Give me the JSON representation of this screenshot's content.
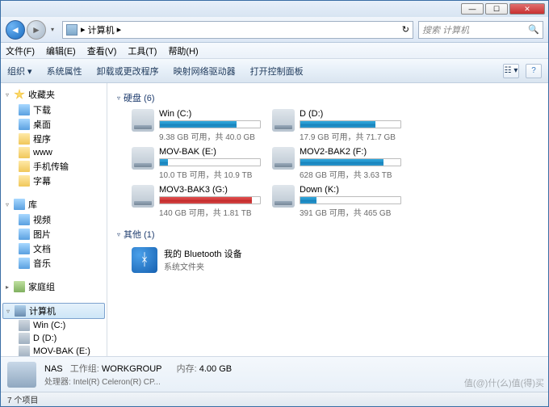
{
  "titlebar": {
    "min": "—",
    "max": "☐",
    "close": "✕"
  },
  "nav": {
    "back": "◄",
    "fwd": "►",
    "drop": "▾",
    "refresh": "↻"
  },
  "breadcrumb": {
    "sep": "▸",
    "loc": "计算机",
    "sep2": "▸"
  },
  "search": {
    "placeholder": "搜索 计算机",
    "icon": "🔍"
  },
  "menubar": [
    "文件(F)",
    "编辑(E)",
    "查看(V)",
    "工具(T)",
    "帮助(H)"
  ],
  "toolbar": {
    "items": [
      "组织 ▾",
      "系统属性",
      "卸载或更改程序",
      "映射网络驱动器",
      "打开控制面板"
    ],
    "view_icon": "☷ ▾",
    "help_icon": "?"
  },
  "sidebar": {
    "favorites": {
      "label": "收藏夹",
      "items": [
        "下载",
        "桌面",
        "程序",
        "www",
        "手机传输",
        "字幕"
      ]
    },
    "libraries": {
      "label": "库",
      "items": [
        "视频",
        "图片",
        "文档",
        "音乐"
      ]
    },
    "homegroup": {
      "label": "家庭组"
    },
    "computer": {
      "label": "计算机",
      "items": [
        "Win (C:)",
        "D (D:)",
        "MOV-BAK (E:)",
        "MOV2-BAK2 (F:)",
        "MOV3-BAK3 (G:)",
        "Down (K:)"
      ]
    }
  },
  "content": {
    "section_drives": "硬盘 (6)",
    "section_other": "其他 (1)",
    "drives": [
      {
        "name": "Win (C:)",
        "text": "9.38 GB 可用，共 40.0 GB",
        "pct": 77,
        "color": "blue"
      },
      {
        "name": "D (D:)",
        "text": "17.9 GB 可用，共 71.7 GB",
        "pct": 75,
        "color": "blue"
      },
      {
        "name": "MOV-BAK (E:)",
        "text": "10.0 TB 可用，共 10.9 TB",
        "pct": 8,
        "color": "blue"
      },
      {
        "name": "MOV2-BAK2 (F:)",
        "text": "628 GB 可用，共 3.63 TB",
        "pct": 83,
        "color": "blue"
      },
      {
        "name": "MOV3-BAK3 (G:)",
        "text": "140 GB 可用，共 1.81 TB",
        "pct": 92,
        "color": "red"
      },
      {
        "name": "Down (K:)",
        "text": "391 GB 可用，共 465 GB",
        "pct": 16,
        "color": "blue"
      }
    ],
    "other": {
      "title": "我的 Bluetooth 设备",
      "sub": "系统文件夹",
      "icon": "ᚼ"
    }
  },
  "details": {
    "name": "NAS",
    "workgroup_label": "工作组:",
    "workgroup": "WORKGROUP",
    "mem_label": "内存:",
    "mem": "4.00 GB",
    "cpu_label": "处理器:",
    "cpu": "Intel(R) Celeron(R) CP..."
  },
  "status": "7 个项目",
  "watermark": "值(@)什(么)值(得)买"
}
